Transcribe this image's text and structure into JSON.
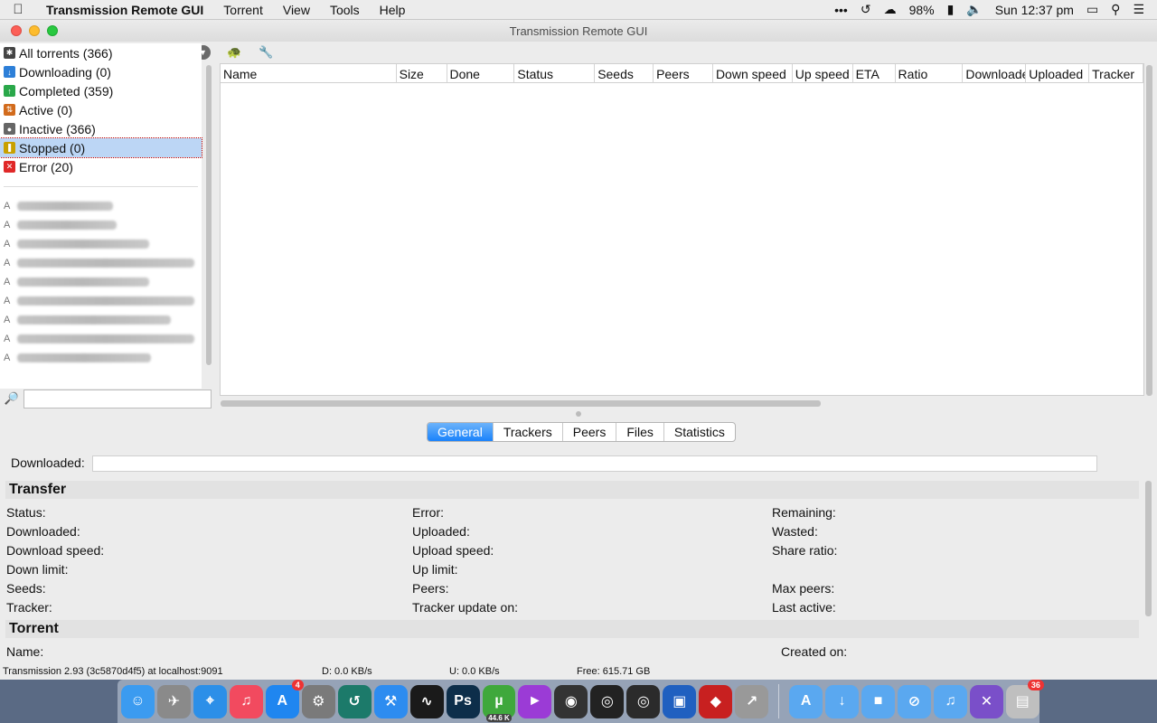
{
  "menubar": {
    "app": "Transmission Remote GUI",
    "items": [
      "Torrent",
      "View",
      "Tools",
      "Help"
    ],
    "battery": "98%",
    "clock": "Sun 12:37 pm"
  },
  "window": {
    "title": "Transmission Remote GUI"
  },
  "filters": [
    {
      "label": "All torrents (366)",
      "icon": "all-icon",
      "color": "#444444"
    },
    {
      "label": "Downloading (0)",
      "icon": "download-icon",
      "color": "#2d7fd8"
    },
    {
      "label": "Completed (359)",
      "icon": "completed-icon",
      "color": "#2aa84a"
    },
    {
      "label": "Active (0)",
      "icon": "active-icon",
      "color": "#d26b1c"
    },
    {
      "label": "Inactive (366)",
      "icon": "inactive-icon",
      "color": "#666666"
    },
    {
      "label": "Stopped (0)",
      "icon": "stopped-icon",
      "color": "#c9a000"
    },
    {
      "label": "Error (20)",
      "icon": "error-icon",
      "color": "#e02828"
    }
  ],
  "columns": [
    "Name",
    "Size",
    "Done",
    "Status",
    "Seeds",
    "Peers",
    "Down speed",
    "Up speed",
    "ETA",
    "Ratio",
    "Downloade",
    "Uploaded",
    "Tracker"
  ],
  "tabs": [
    "General",
    "Trackers",
    "Peers",
    "Files",
    "Statistics"
  ],
  "details": {
    "downloaded_label": "Downloaded:",
    "transfer_title": "Transfer",
    "transfer_col1": [
      "Status:",
      "Downloaded:",
      "Download speed:",
      "Down limit:",
      "Seeds:",
      "Tracker:"
    ],
    "transfer_col2": [
      "Error:",
      "Uploaded:",
      "Upload speed:",
      "Up limit:",
      "Peers:",
      "Tracker update on:"
    ],
    "transfer_col3": [
      "Remaining:",
      "Wasted:",
      "Share ratio:",
      "",
      "Max peers:",
      "Last active:"
    ],
    "torrent_title": "Torrent",
    "name_label": "Name:",
    "created_label": "Created on:"
  },
  "status": {
    "connection": "Transmission 2.93 (3c5870d4f5) at localhost:9091",
    "down": "D: 0.0 KB/s",
    "up": "U: 0.0 KB/s",
    "free": "Free: 615.71 GB"
  },
  "dock": [
    {
      "name": "finder-icon",
      "color": "#3b9bf0"
    },
    {
      "name": "launchpad-icon",
      "color": "#8a8a8a"
    },
    {
      "name": "safari-icon",
      "color": "#2c8fe8"
    },
    {
      "name": "itunes-icon",
      "color": "#f24a5f"
    },
    {
      "name": "appstore-icon",
      "color": "#1f86f0",
      "badge": "4"
    },
    {
      "name": "system-preferences-icon",
      "color": "#7a7a7a"
    },
    {
      "name": "time-machine-icon",
      "color": "#1c7a6a"
    },
    {
      "name": "tool-icon",
      "color": "#2d8cf0"
    },
    {
      "name": "activity-monitor-icon",
      "color": "#1a1a1a"
    },
    {
      "name": "photoshop-icon",
      "color": "#0d2e4a"
    },
    {
      "name": "utorrent-icon",
      "color": "#3fa83c",
      "sub": "44.6 K"
    },
    {
      "name": "megaphone-icon",
      "color": "#9b3bd6"
    },
    {
      "name": "podcast-icon",
      "color": "#333333"
    },
    {
      "name": "music-player-icon",
      "color": "#222222"
    },
    {
      "name": "disk-icon",
      "color": "#2b2b2b"
    },
    {
      "name": "display-icon",
      "color": "#2060c0"
    },
    {
      "name": "cubase-icon",
      "color": "#c82020"
    },
    {
      "name": "installer-icon",
      "color": "#999999"
    },
    {
      "name": "applications-folder-icon",
      "color": "#5aa8f0"
    },
    {
      "name": "downloads-folder-icon",
      "color": "#5aa8f0"
    },
    {
      "name": "games-folder-icon",
      "color": "#5aa8f0"
    },
    {
      "name": "safari-folder-icon",
      "color": "#5aa8f0"
    },
    {
      "name": "music-folder-icon",
      "color": "#5aa8f0"
    },
    {
      "name": "xcode-folder-icon",
      "color": "#7a4fc9"
    },
    {
      "name": "trash-icon",
      "color": "#bfbfbf",
      "badge": "36"
    }
  ]
}
